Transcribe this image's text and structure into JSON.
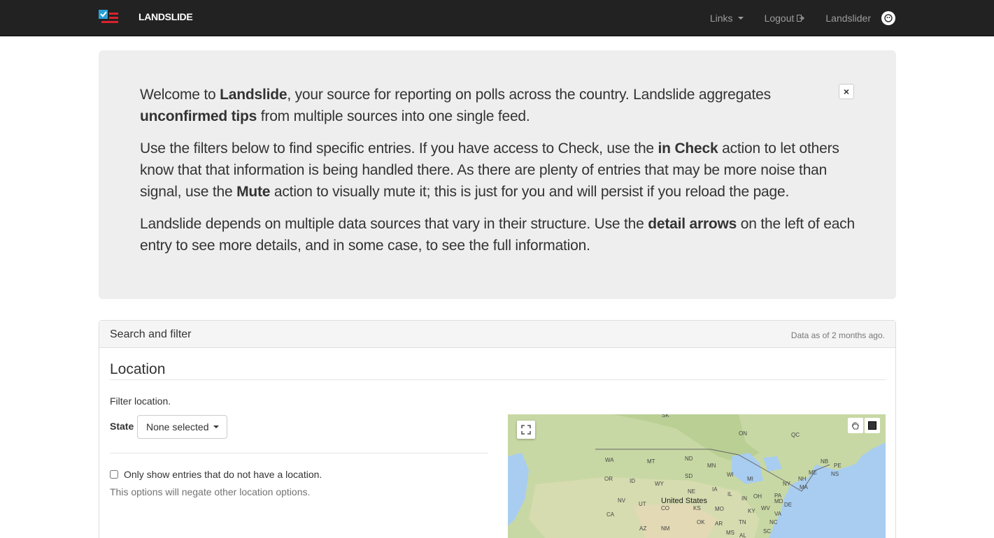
{
  "navbar": {
    "brand": "LANDSLIDE",
    "links_label": "Links",
    "logout_label": "Logout",
    "user_label": "Landslider"
  },
  "welcome": {
    "p1_a": "Welcome to ",
    "p1_b": "Landslide",
    "p1_c": ", your source for reporting on polls across the country. Landslide aggregates ",
    "p1_d": "unconfirmed tips",
    "p1_e": " from multiple sources into one single feed.",
    "p2_a": "Use the filters below to find specific entries. If you have access to Check, use the ",
    "p2_b": "in Check",
    "p2_c": " action to let others know that that information is being handled there. As there are plenty of entries that may be more noise than signal, use the ",
    "p2_d": "Mute",
    "p2_e": " action to visually mute it; this is just for you and will persist if you reload the page.",
    "p3_a": "Landslide depends on multiple data sources that vary in their structure. Use the ",
    "p3_b": "detail arrows",
    "p3_c": " on the left of each entry to see more details, and in some case, to see the full information.",
    "close_glyph": "×"
  },
  "filter_panel": {
    "title": "Search and filter",
    "data_age": "Data as of 2 months ago.",
    "location_heading": "Location",
    "filter_label": "Filter location.",
    "state_label": "State",
    "state_value": "None selected",
    "no_location_label": "Only show entries that do not have a location.",
    "help_text": "This options will negate other location options."
  },
  "map": {
    "country_label": "United States",
    "labels": [
      "SK",
      "ON",
      "QC",
      "WA",
      "MT",
      "ND",
      "MN",
      "NB",
      "PE",
      "ME",
      "NS",
      "OR",
      "ID",
      "SD",
      "WI",
      "MI",
      "NY",
      "NH",
      "MA",
      "WY",
      "NE",
      "IA",
      "PA",
      "NV",
      "UT",
      "CO",
      "IL",
      "IN",
      "OH",
      "MD",
      "DE",
      "CA",
      "KS",
      "MO",
      "KY",
      "WV",
      "VA",
      "AZ",
      "NM",
      "OK",
      "AR",
      "TN",
      "NC",
      "MS",
      "SC",
      "AL"
    ]
  },
  "colors": {
    "navbar_bg": "#222222",
    "jumbotron_bg": "#eeeeee",
    "brand_red": "#d9232d",
    "brand_blue": "#2a9fd6"
  }
}
